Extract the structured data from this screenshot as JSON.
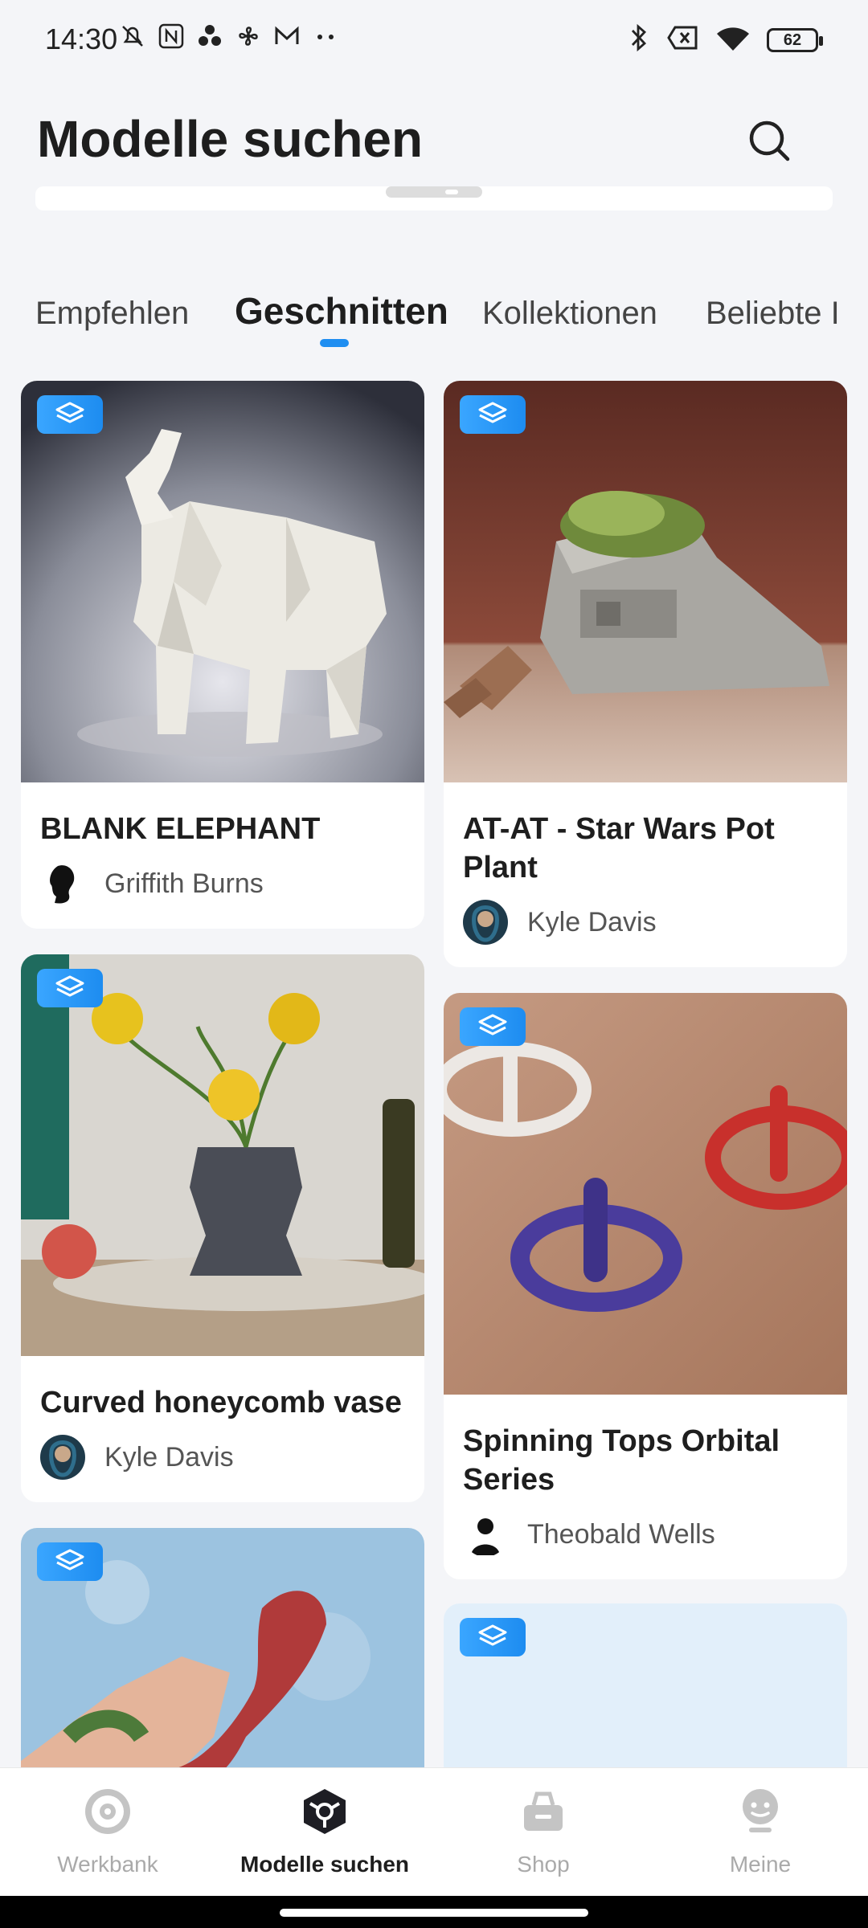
{
  "status_bar": {
    "time": "14:30",
    "battery": "62"
  },
  "header": {
    "title": "Modelle suchen"
  },
  "tabs": [
    {
      "label": "Empfehlen"
    },
    {
      "label": "Geschnitten"
    },
    {
      "label": "Kollektionen"
    },
    {
      "label": "Beliebte I"
    }
  ],
  "cards": [
    {
      "title": "BLANK ELEPHANT",
      "author": "Griffith Burns"
    },
    {
      "title": "AT-AT - Star Wars Pot Plant",
      "author": "Kyle Davis"
    },
    {
      "title": "Curved honeycomb vase",
      "author": "Kyle Davis"
    },
    {
      "title": "Spinning Tops Orbital Series",
      "author": "Theobald Wells"
    },
    {
      "title": "",
      "author": ""
    },
    {
      "title": "",
      "author": ""
    }
  ],
  "bottom_nav": [
    {
      "label": "Werkbank",
      "icon": "workbench-icon"
    },
    {
      "label": "Modelle suchen",
      "icon": "models-icon"
    },
    {
      "label": "Shop",
      "icon": "shop-icon"
    },
    {
      "label": "Meine",
      "icon": "profile-icon"
    }
  ],
  "colors": {
    "accent": "#1f8ef1",
    "badge": "#2a9bf5"
  }
}
